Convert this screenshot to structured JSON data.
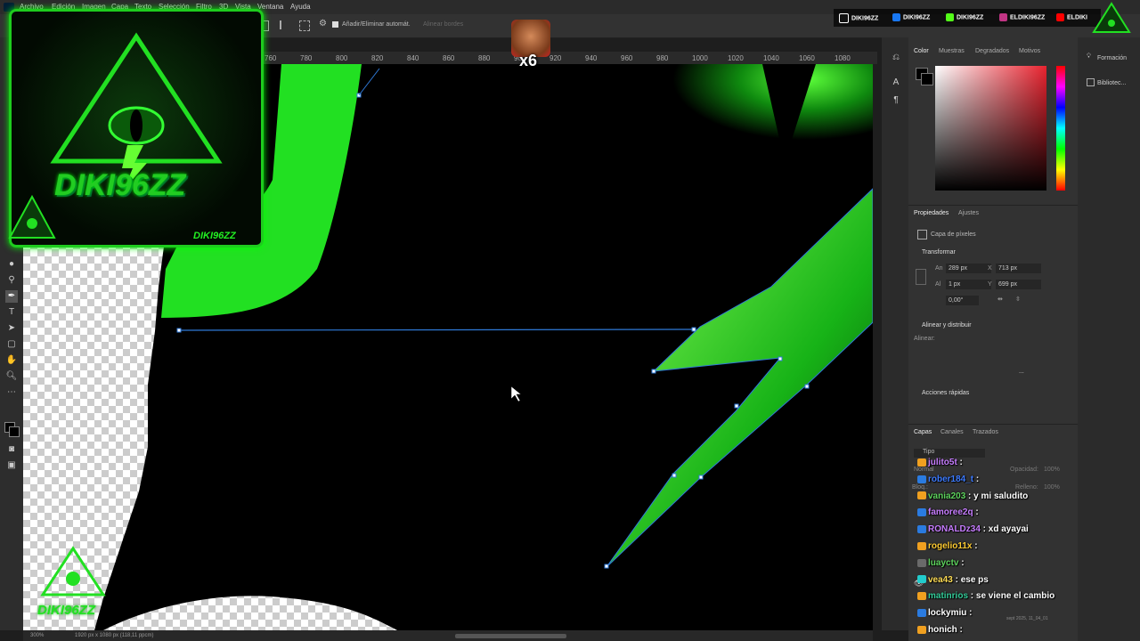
{
  "menu": [
    "Archivo",
    "Edición",
    "Imagen",
    "Capa",
    "Texto",
    "Selección",
    "Filtro",
    "3D",
    "Vista",
    "Ventana",
    "Ayuda"
  ],
  "options_bar": {
    "auto_add_delete": "Añadir/Eliminar automát.",
    "align_edges": "Alinear bordes"
  },
  "ruler_ticks": [
    "760",
    "780",
    "800",
    "820",
    "840",
    "860",
    "880",
    "900",
    "920",
    "940",
    "960",
    "980",
    "1000",
    "1020",
    "1040",
    "1060",
    "1080"
  ],
  "status": {
    "zoom": "300%",
    "doc_size": "1920 px x 1080 px (118,11 ppcm)"
  },
  "overlay": {
    "brand_name": "DIKI96ZZ",
    "small_brand": "DIKI96ZZ",
    "bottom_brand": "DIKI96ZZ",
    "multiplier": "x6",
    "social": [
      {
        "icon": "tiktok-icon",
        "label": "DIKI96ZZ",
        "color": "#000000"
      },
      {
        "icon": "facebook-icon",
        "label": "DIKI96ZZ",
        "color": "#1877f2"
      },
      {
        "icon": "kick-icon",
        "label": "DIKI96ZZ",
        "color": "#53fc18"
      },
      {
        "icon": "instagram-icon",
        "label": "ELDIKI96ZZ",
        "color": "#c13584"
      },
      {
        "icon": "youtube-icon",
        "label": "ELDIKI",
        "color": "#ff0000"
      }
    ]
  },
  "panels": {
    "color_tabs": [
      "Color",
      "Muestras",
      "Degradados",
      "Motivos"
    ],
    "far_right": [
      "Formación",
      "Bibliotec..."
    ],
    "props_tabs": [
      "Propiedades",
      "Ajustes"
    ],
    "layer_kind": "Capa de píxeles",
    "transform_title": "Transformar",
    "transform": {
      "an_label": "An",
      "an": "289 px",
      "x_label": "X",
      "x": "713 px",
      "al_label": "Al",
      "al": "1 px",
      "y_label": "Y",
      "y": "699 px",
      "angle": "0,00°"
    },
    "align_title": "Alinear y distribuir",
    "align_label": "Alinear:",
    "quick_title": "Acciones rápidas",
    "layers_tabs": [
      "Capas",
      "Canales",
      "Trazados"
    ],
    "layers_filter": "Tipo",
    "blend": "Normal",
    "opacity_label": "Opacidad:",
    "opacity": "100%",
    "lock_label": "Bloq.:",
    "fill_label": "Relleno:",
    "fill": "100%",
    "date_text": "sept 2025, 11_04_01",
    "more": "..."
  },
  "chat": [
    {
      "user": "julito5t",
      "msg": "",
      "color": "#c77dff"
    },
    {
      "user": "rober184_t",
      "msg": "",
      "color": "#3d7bff"
    },
    {
      "user": "vania203",
      "msg": "y mi saludito",
      "color": "#5dd25d"
    },
    {
      "user": "famoree2q",
      "msg": "",
      "color": "#c77dff"
    },
    {
      "user": "RONALDz34",
      "msg": "xd ayayai",
      "color": "#c77dff"
    },
    {
      "user": "rogelio11x",
      "msg": "",
      "color": "#ffcc33"
    },
    {
      "user": "luayctv",
      "msg": "",
      "color": "#5dd25d"
    },
    {
      "user": "vea43",
      "msg": "ese ps",
      "color": "#ffdd55"
    },
    {
      "user": "matinrios",
      "msg": "se viene el cambio",
      "color": "#33cc99"
    },
    {
      "user": "lockymiu",
      "msg": "",
      "color": "#ffffff"
    },
    {
      "user": "honich",
      "msg": "",
      "color": "#ffffff"
    }
  ]
}
